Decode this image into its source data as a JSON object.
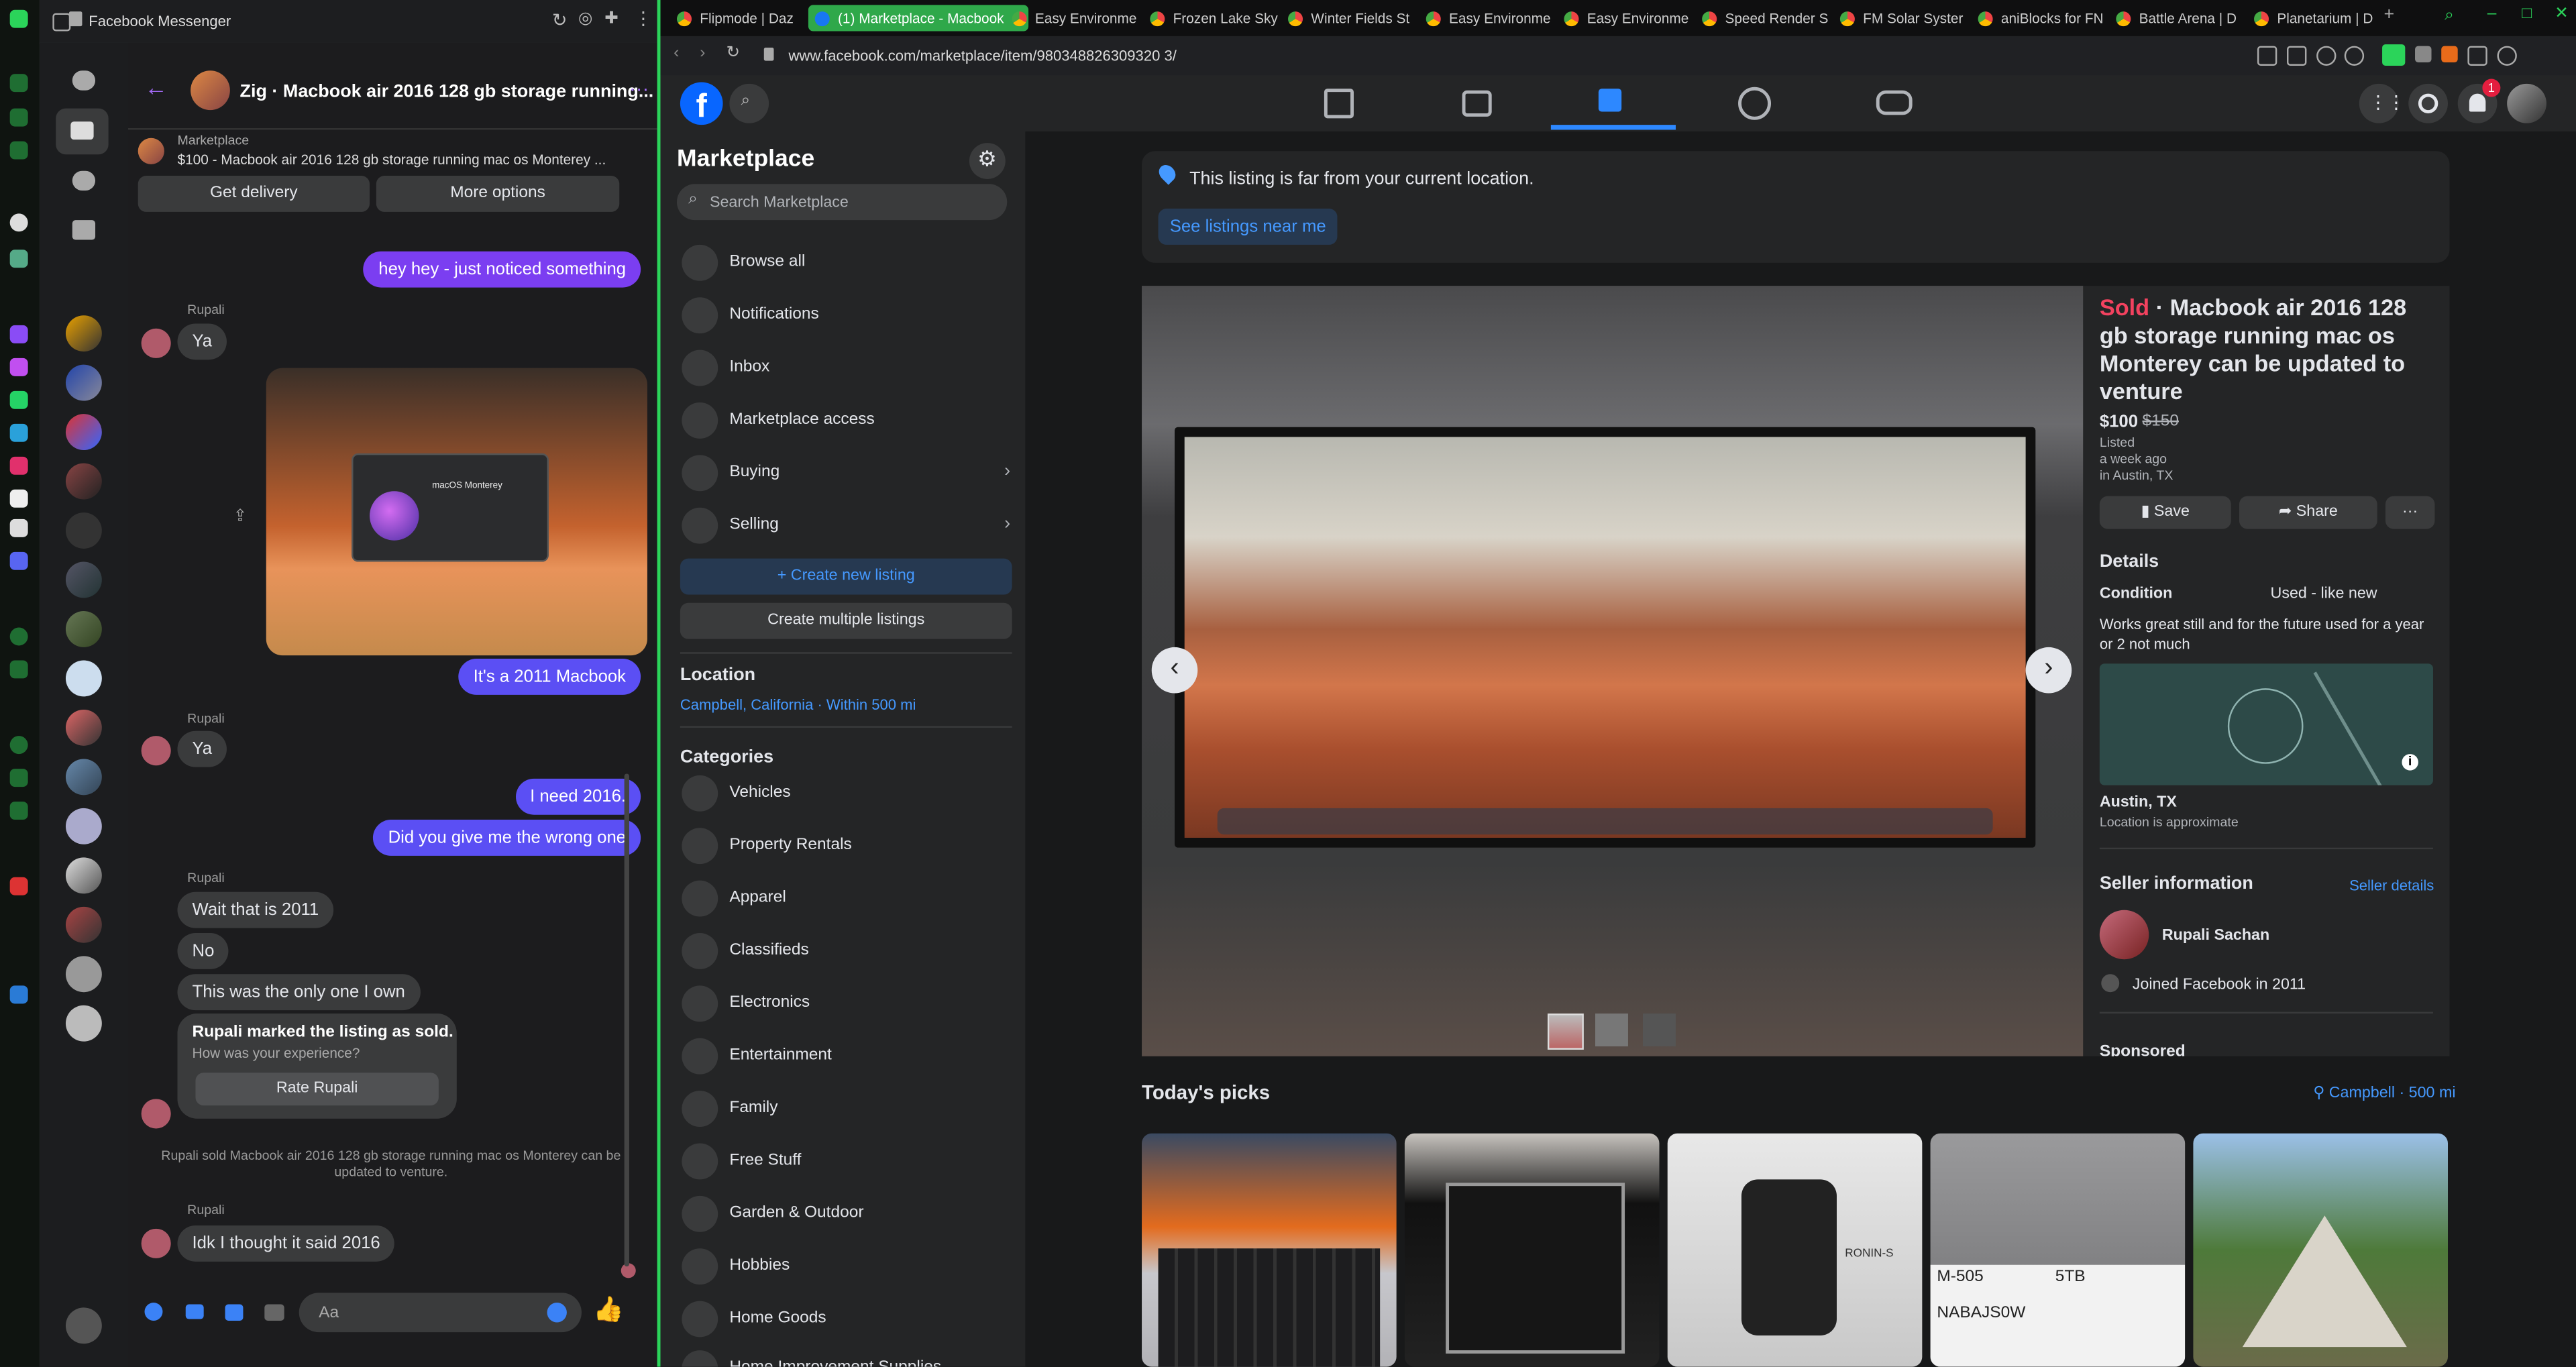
{
  "messenger": {
    "window_title": "Facebook Messenger",
    "chat_title": "Zig · Macbook air 2016 128 gb storage running...",
    "listing_label": "Marketplace",
    "listing_text": "$100 - Macbook air 2016 128 gb storage running mac os Monterey ...",
    "get_delivery": "Get delivery",
    "more_options": "More options",
    "sender_name": "Rupali",
    "screenshot_title": "macOS Monterey",
    "messages": {
      "m1": "hey hey - just noticed something",
      "m2": "Ya",
      "m3": "It's a 2011 Macbook",
      "m4": "Ya",
      "m5": "I need 2016.",
      "m6": "Did you give me the wrong one",
      "m7": "Wait that is 2011",
      "m8": "No",
      "m9": "This was the only one I own",
      "m10": "Idk I thought it said 2016"
    },
    "sold_title": "Rupali marked the listing as sold.",
    "sold_sub": "How was your experience?",
    "rate_button": "Rate Rupali",
    "system_msg": "Rupali sold Macbook air 2016 128 gb storage running mac os Monterey can be updated to venture.",
    "composer_placeholder": "Aa"
  },
  "browser": {
    "tabs": [
      "Flipmode | Daz",
      "(1) Marketplace - Macbook",
      "Easy Environme",
      "Frozen Lake Sky",
      "Winter Fields St",
      "Easy Environme",
      "Easy Environme",
      "Speed Render S",
      "FM Solar Syster",
      "aniBlocks for FN",
      "Battle Arena | D",
      "Planetarium | D"
    ],
    "url": "www.facebook.com/marketplace/item/980348826309320 3/",
    "notification_count": "1"
  },
  "marketplace": {
    "heading": "Marketplace",
    "search_placeholder": "Search Marketplace",
    "nav": {
      "browse": "Browse all",
      "notifications": "Notifications",
      "inbox": "Inbox",
      "access": "Marketplace access",
      "buying": "Buying",
      "selling": "Selling"
    },
    "create_listing": "+ Create new listing",
    "create_multiple": "Create multiple listings",
    "location_heading": "Location",
    "location_value": "Campbell, California · Within 500 mi",
    "categories_heading": "Categories",
    "categories": {
      "c1": "Vehicles",
      "c2": "Property Rentals",
      "c3": "Apparel",
      "c4": "Classifieds",
      "c5": "Electronics",
      "c6": "Entertainment",
      "c7": "Family",
      "c8": "Free Stuff",
      "c9": "Garden & Outdoor",
      "c10": "Hobbies",
      "c11": "Home Goods",
      "c12": "Home Improvement Supplies"
    }
  },
  "listing": {
    "far_notice": "This listing is far from your current location.",
    "see_near": "See listings near me",
    "sold": "Sold",
    "title": " · Macbook air 2016 128 gb storage running mac os Monterey can be updated to venture",
    "price": "$100",
    "old_price": "$150",
    "listed": "Listed",
    "listed_when": "a week ago",
    "listed_where": "in Austin, TX",
    "save": "Save",
    "share": "Share",
    "more": "···",
    "details_heading": "Details",
    "condition_label": "Condition",
    "condition_value": "Used - like new",
    "description": "Works great still and for the future used for a year or 2 not much",
    "map_city": "Austin, TX",
    "map_note": "Location is approximate",
    "seller_heading": "Seller information",
    "seller_details": "Seller details",
    "seller_name": "Rupali Sachan",
    "seller_joined": "Joined Facebook in 2011",
    "sponsored": "Sponsored",
    "picks_heading": "Today's picks",
    "picks_location": "Campbell · 500 mi",
    "pick_texts": {
      "p4a": "M-505",
      "p4b": "5TB",
      "p4c": "NABAJS0W",
      "p3": "RONIN-S"
    }
  },
  "colors": {
    "fb_blue": "#0866ff",
    "sold_red": "#f3425f",
    "messenger_purple": "#7b3ef1",
    "accent_green": "#2bd45a"
  }
}
